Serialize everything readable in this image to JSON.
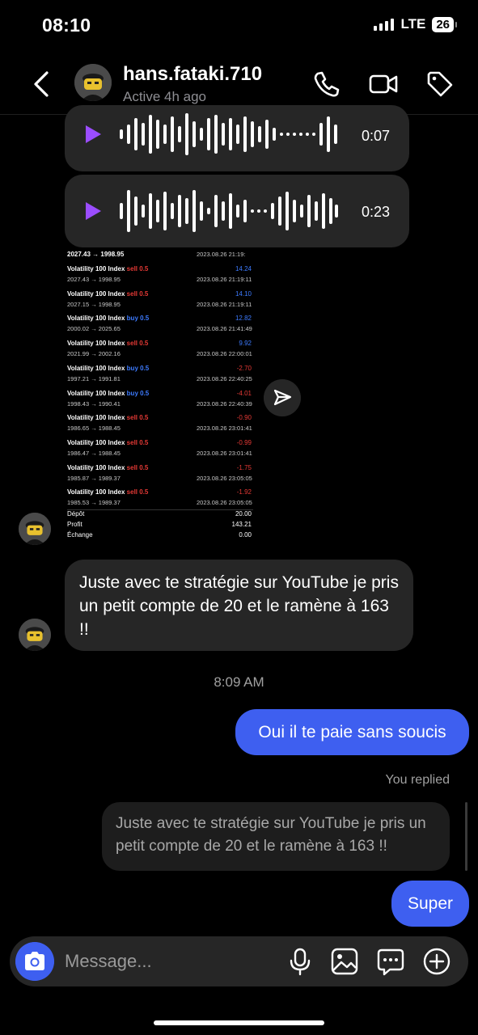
{
  "status_bar": {
    "time": "08:10",
    "network": "LTE",
    "battery": "26"
  },
  "header": {
    "name": "hans.fataki.710",
    "status": "Active 4h ago"
  },
  "voice_messages": [
    {
      "duration": "0:07"
    },
    {
      "duration": "0:23"
    }
  ],
  "screenshot": {
    "first_prices": "2027.43 → 1998.95",
    "first_time": "2023.08.26 21:19:",
    "trades": [
      {
        "symbol": "Volatility 100 Index",
        "side": "sell 0.5",
        "prices": "2027.43 → 1998.95",
        "pnl": "14.24",
        "time": "2023.08.26 21:19:11"
      },
      {
        "symbol": "Volatility 100 Index",
        "side": "sell 0.5",
        "prices": "2027.15 → 1998.95",
        "pnl": "14.10",
        "time": "2023.08.26 21:19:11"
      },
      {
        "symbol": "Volatility 100 Index",
        "side": "buy 0.5",
        "prices": "2000.02 → 2025.65",
        "pnl": "12.82",
        "time": "2023.08.26 21:41:49"
      },
      {
        "symbol": "Volatility 100 Index",
        "side": "sell 0.5",
        "prices": "2021.99 → 2002.16",
        "pnl": "9.92",
        "time": "2023.08.26 22:00:01"
      },
      {
        "symbol": "Volatility 100 Index",
        "side": "buy 0.5",
        "prices": "1997.21 → 1991.81",
        "pnl": "-2.70",
        "time": "2023.08.26 22:40:25"
      },
      {
        "symbol": "Volatility 100 Index",
        "side": "buy 0.5",
        "prices": "1998.43 → 1990.41",
        "pnl": "-4.01",
        "time": "2023.08.26 22:40:39"
      },
      {
        "symbol": "Volatility 100 Index",
        "side": "sell 0.5",
        "prices": "1986.65 → 1988.45",
        "pnl": "-0.90",
        "time": "2023.08.26 23:01:41"
      },
      {
        "symbol": "Volatility 100 Index",
        "side": "sell 0.5",
        "prices": "1986.47 → 1988.45",
        "pnl": "-0.99",
        "time": "2023.08.26 23:01:41"
      },
      {
        "symbol": "Volatility 100 Index",
        "side": "sell 0.5",
        "prices": "1985.87 → 1989.37",
        "pnl": "-1.75",
        "time": "2023.08.26 23:05:05"
      },
      {
        "symbol": "Volatility 100 Index",
        "side": "sell 0.5",
        "prices": "1985.53 → 1989.37",
        "pnl": "-1.92",
        "time": "2023.08.26 23:05:05"
      }
    ],
    "summary": [
      {
        "label": "Dépôt",
        "value": "20.00"
      },
      {
        "label": "Profit",
        "value": "143.21"
      },
      {
        "label": "Échange",
        "value": "0.00"
      }
    ]
  },
  "messages": {
    "incoming_text": "Juste avec te stratégie sur YouTube je pris un petit compte de 20 et le ramène à 163 !!",
    "time_separator": "8:09 AM",
    "outgoing_1": "Oui il te paie sans soucis",
    "you_replied": "You replied",
    "quoted_text": "Juste avec te stratégie sur YouTube je pris un petit compte de 20 et le ramène à 163 !!",
    "outgoing_2": "Super"
  },
  "composer": {
    "placeholder": "Message..."
  },
  "colors": {
    "accent": "#3e5ff0",
    "play": "#9b4dff",
    "bubble": "#262626"
  }
}
